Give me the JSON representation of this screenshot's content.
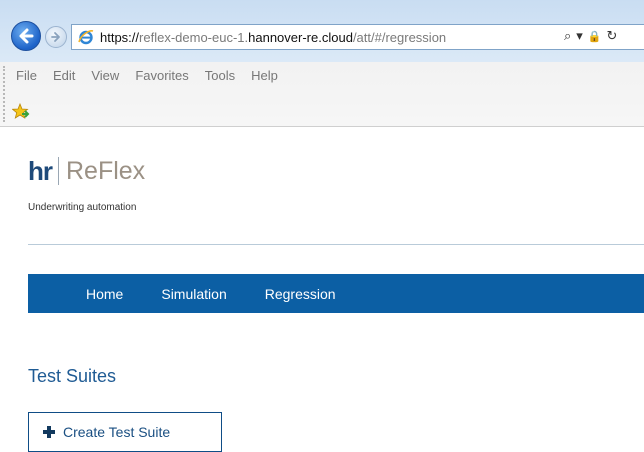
{
  "browser": {
    "url_scheme": "https://",
    "url_pre_host": "reflex-demo-euc-1.",
    "url_host": "hannover-re.cloud",
    "url_path": "/att/#/regression",
    "search_glyph": "⌕",
    "dropdown_glyph": "▾",
    "lock_glyph": "🔒",
    "refresh_glyph": "↻",
    "menu": [
      "File",
      "Edit",
      "View",
      "Favorites",
      "Tools",
      "Help"
    ]
  },
  "brand": {
    "logo_mark": "hr",
    "logo_name": "ReFlex",
    "tagline": "Underwriting automation"
  },
  "nav": {
    "items": [
      "Home",
      "Simulation",
      "Regression"
    ]
  },
  "page": {
    "title": "Test Suites",
    "create_button_label": "Create Test Suite"
  },
  "colors": {
    "nav_bg": "#0c5fa4",
    "brand_blue": "#1e4a7a",
    "title_blue": "#1f5b94"
  },
  "icons": {
    "back": "back-arrow-icon",
    "forward": "forward-arrow-icon",
    "browser": "ie-logo-icon",
    "favorites": "add-favorite-star-icon",
    "create": "plus-icon"
  }
}
